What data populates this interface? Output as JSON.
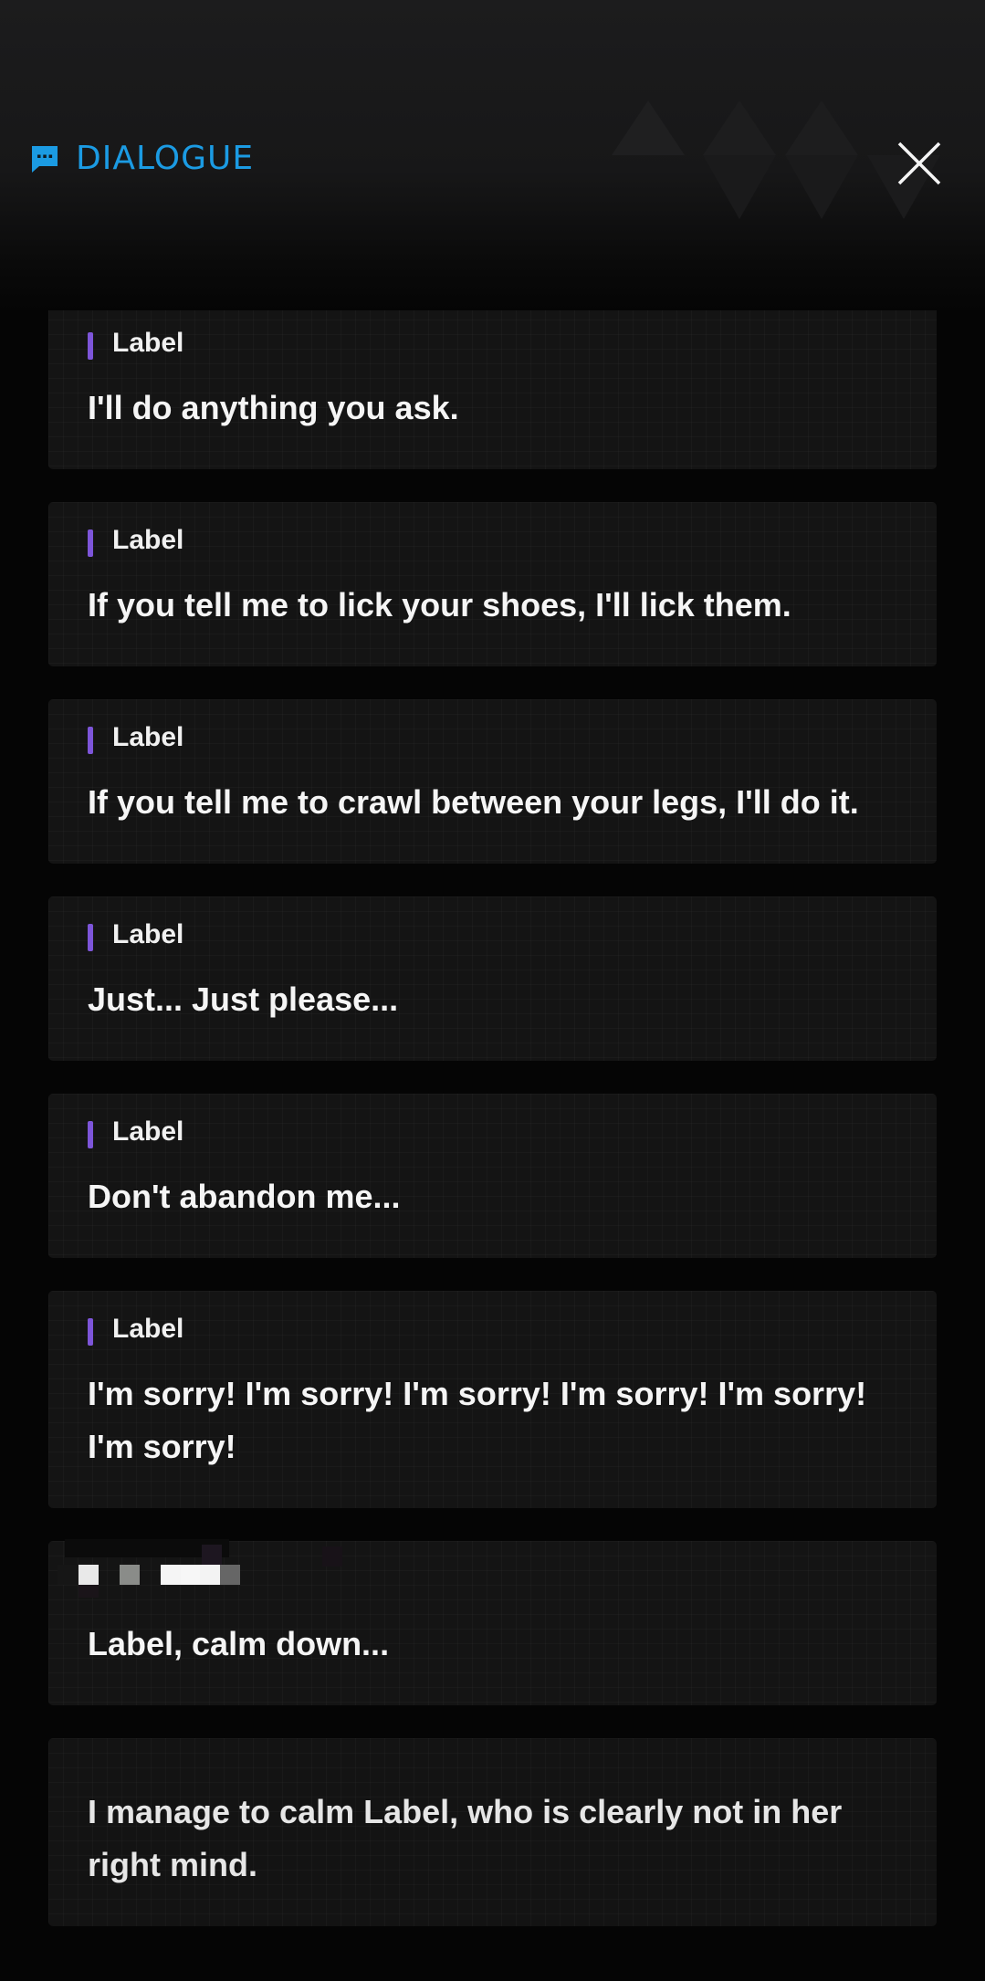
{
  "header": {
    "title": "DIALOGUE",
    "accent_color": "#1b9be3",
    "icon": "chat-bubble-icon",
    "close_icon": "close-icon"
  },
  "speaker_bar_color": "#7d55d9",
  "dialogue": [
    {
      "speaker": "Label",
      "text": "I'll do anything you ask."
    },
    {
      "speaker": "Label",
      "text": "If you tell me to lick your shoes, I'll lick them."
    },
    {
      "speaker": "Label",
      "text": "If you tell me to crawl between your legs, I'll do it."
    },
    {
      "speaker": "Label",
      "text": "Just... Just please..."
    },
    {
      "speaker": "Label",
      "text": "Don't abandon me..."
    },
    {
      "speaker": "Label",
      "text": "I'm sorry! I'm sorry! I'm sorry! I'm sorry! I'm sorry! I'm sorry!"
    },
    {
      "speaker_pixelated": true,
      "text": "Label, calm down..."
    }
  ],
  "narration": {
    "text": "I manage to calm Label, who is clearly not in her right mind."
  }
}
